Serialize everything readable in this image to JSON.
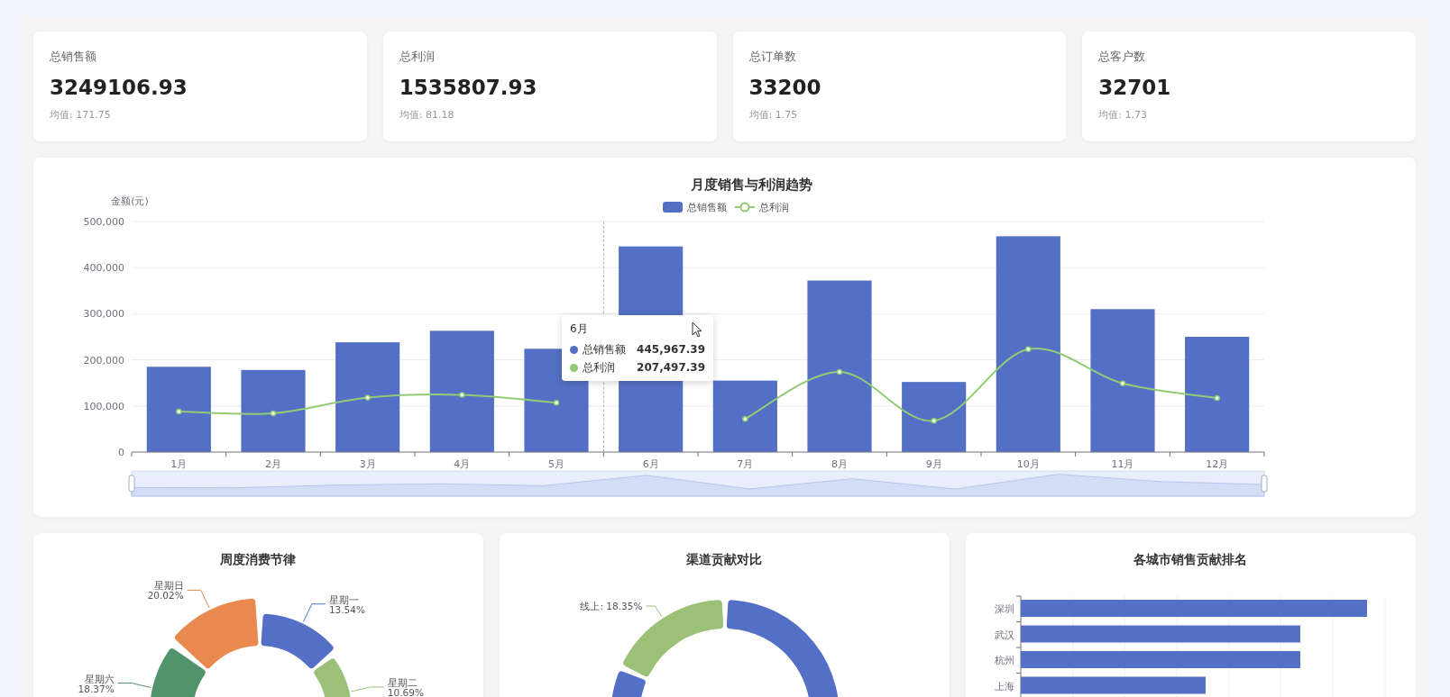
{
  "stats": [
    {
      "label": "总销售额",
      "value": "3249106.93",
      "average": "均值: 171.75"
    },
    {
      "label": "总利润",
      "value": "1535807.93",
      "average": "均值: 81.18"
    },
    {
      "label": "总订单数",
      "value": "33200",
      "average": "均值: 1.75"
    },
    {
      "label": "总客户数",
      "value": "32701",
      "average": "均值: 1.73"
    }
  ],
  "trend_chart": {
    "chart_data": {
      "type": "bar",
      "title": "月度销售与利润趋势",
      "ylabel": "金额(元)",
      "categories": [
        "1月",
        "2月",
        "3月",
        "4月",
        "5月",
        "6月",
        "7月",
        "8月",
        "9月",
        "10月",
        "11月",
        "12月"
      ],
      "series": [
        {
          "name": "总销售额",
          "type": "bar",
          "color": "#5470c6",
          "values": [
            185000,
            178000,
            238000,
            263000,
            224000,
            446000,
            155000,
            372000,
            152000,
            468000,
            310000,
            250000
          ]
        },
        {
          "name": "总利润",
          "type": "line",
          "color": "#91cc75",
          "marker": true,
          "values": [
            88000,
            84000,
            118000,
            124000,
            107000,
            null,
            72000,
            174000,
            68000,
            223000,
            149000,
            117000
          ]
        }
      ],
      "stacked": false,
      "grid": true,
      "legend": "top",
      "ylim": [
        0,
        500000
      ],
      "yticks": [
        {
          "value": 0,
          "label": "0"
        },
        {
          "value": 100000,
          "label": "100,000"
        },
        {
          "value": 200000,
          "label": "200,000"
        },
        {
          "value": 300000,
          "label": "300,000"
        },
        {
          "value": 400000,
          "label": "400,000"
        },
        {
          "value": 500000,
          "label": "500,000"
        }
      ]
    },
    "tooltip": {
      "title": "6月",
      "rows": [
        {
          "name": "总销售额",
          "value": "445,967.39",
          "color": "#5470c6"
        },
        {
          "name": "总利润",
          "value": "207,497.39",
          "color": "#91cc75"
        }
      ]
    }
  },
  "weekly_chart": {
    "title": "周度消费节律",
    "slices": [
      {
        "label": "星期六",
        "share": "18.37%",
        "color": "#52936d"
      },
      {
        "label": "星期日",
        "share": "20.02%",
        "color": "#e98950"
      },
      {
        "label": "星期一",
        "share": "13.54%",
        "color": "#5470c6"
      },
      {
        "label": "星期二",
        "share": "10.69%",
        "color": "#9bc077"
      }
    ]
  },
  "channel_chart": {
    "title": "渠道贡献对比",
    "slices": [
      {
        "label": "线上: 18.35%",
        "color": "#9bc077"
      }
    ]
  },
  "city_chart": {
    "title": "各城市销售贡献排名",
    "categories": [
      "深圳",
      "武汉",
      "杭州",
      "上海"
    ]
  }
}
